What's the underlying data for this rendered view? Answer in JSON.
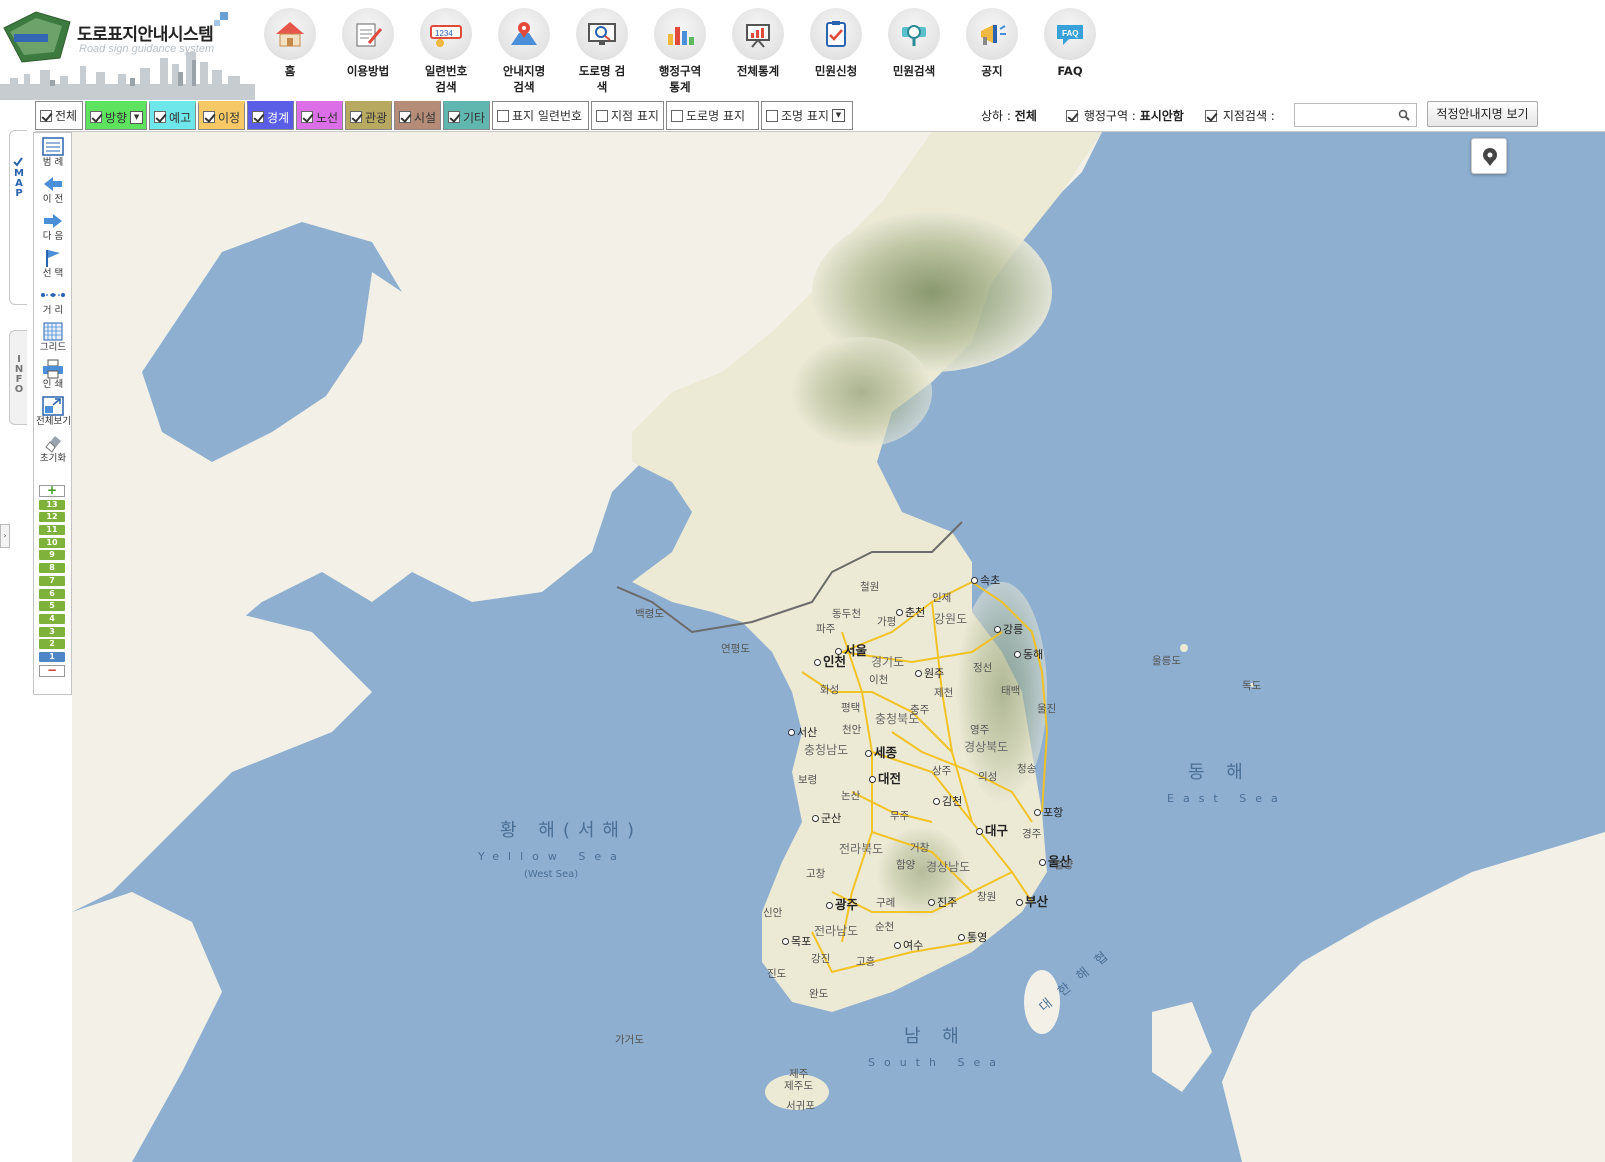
{
  "header": {
    "title": "도로표지안내시스템",
    "subtitle": "Road sign guidance system"
  },
  "nav": [
    {
      "label": "홈",
      "icon": "home-icon"
    },
    {
      "label": "이용방법",
      "icon": "guide-icon"
    },
    {
      "label": "일련번호\n검색",
      "icon": "serial-number-icon"
    },
    {
      "label": "안내지명\n검색",
      "icon": "place-pin-icon"
    },
    {
      "label": "도로명 검\n색",
      "icon": "road-search-icon"
    },
    {
      "label": "행정구역\n통계",
      "icon": "bar-chart-icon"
    },
    {
      "label": "전체통계",
      "icon": "presentation-chart-icon"
    },
    {
      "label": "민원신청",
      "icon": "clipboard-check-icon"
    },
    {
      "label": "민원검색",
      "icon": "magnifier-icon"
    },
    {
      "label": "공지",
      "icon": "megaphone-icon"
    },
    {
      "label": "FAQ",
      "icon": "faq-bubble-icon"
    }
  ],
  "filters": [
    {
      "label": "전체",
      "checked": true,
      "color": "#ffffff",
      "dropdown": false
    },
    {
      "label": "방향",
      "checked": true,
      "color": "#5ee35e",
      "dropdown": true
    },
    {
      "label": "예고",
      "checked": true,
      "color": "#6ee7ea",
      "dropdown": false
    },
    {
      "label": "이정",
      "checked": true,
      "color": "#f6c866",
      "dropdown": false
    },
    {
      "label": "경계",
      "checked": true,
      "color": "#5a5ee6",
      "dropdown": false
    },
    {
      "label": "노선",
      "checked": true,
      "color": "#dc6fe8",
      "dropdown": false
    },
    {
      "label": "관광",
      "checked": true,
      "color": "#b8a960",
      "dropdown": false
    },
    {
      "label": "시설",
      "checked": true,
      "color": "#b58c78",
      "dropdown": false
    },
    {
      "label": "기타",
      "checked": true,
      "color": "#5fb7b0",
      "dropdown": false
    },
    {
      "label": "표지 일련번호",
      "checked": false,
      "color": "#ffffff",
      "dropdown": false
    },
    {
      "label": "지점 표지",
      "checked": false,
      "color": "#ffffff",
      "dropdown": false
    },
    {
      "label": "도로명 표지",
      "checked": false,
      "color": "#ffffff",
      "dropdown": false
    },
    {
      "label": "조명 표지",
      "checked": false,
      "color": "#ffffff",
      "dropdown": true
    }
  ],
  "status": {
    "direction_label": "상하 :",
    "direction_value": "전체",
    "admin_label": "행정구역 :",
    "admin_value": "표시안함",
    "point_search_label": "지점검색 :",
    "search_value": "",
    "map_button": "적정안내지명 보기"
  },
  "side_tabs": {
    "map": "MAP",
    "info": "INFO"
  },
  "tools": [
    {
      "label": "범 례",
      "icon": "legend-icon"
    },
    {
      "label": "이 전",
      "icon": "arrow-left-icon"
    },
    {
      "label": "다 음",
      "icon": "arrow-right-icon"
    },
    {
      "label": "선 택",
      "icon": "flag-icon"
    },
    {
      "label": "거 리",
      "icon": "distance-icon"
    },
    {
      "label": "그리드",
      "icon": "grid-icon"
    },
    {
      "label": "인 쇄",
      "icon": "printer-icon"
    },
    {
      "label": "전체보기",
      "icon": "full-extent-icon"
    },
    {
      "label": "초기화",
      "icon": "eraser-icon"
    }
  ],
  "zoom": {
    "plus": "+",
    "minus": "−",
    "levels": [
      "13",
      "12",
      "11",
      "10",
      "9",
      "8",
      "7",
      "6",
      "5",
      "4",
      "3",
      "2",
      "1"
    ],
    "current": "1"
  },
  "map": {
    "seas": {
      "yellow_kr": "황 해(서해)",
      "yellow_en": "Yellow Sea",
      "yellow_sub": "(West Sea)",
      "east_kr": "동 해",
      "east_en": "East Sea",
      "south_kr": "남 해",
      "south_en": "South Sea",
      "strait": "대 한 해 협"
    },
    "major_cities": [
      "서울",
      "인천",
      "세종",
      "대전",
      "대구",
      "광주",
      "부산",
      "울산"
    ],
    "cities": [
      "속초",
      "춘천",
      "강릉",
      "동해",
      "원주",
      "서산",
      "김천",
      "군산",
      "포항",
      "진주",
      "목포",
      "여수",
      "통영"
    ],
    "provinces": [
      "경기도",
      "강원도",
      "충청북도",
      "충청남도",
      "경상북도",
      "전라북도",
      "경상남도",
      "전라남도"
    ],
    "places": [
      "철원",
      "인제",
      "동두천",
      "가평",
      "파주",
      "백령도",
      "연평도",
      "화성",
      "이천",
      "정선",
      "평택",
      "제천",
      "충주",
      "태백",
      "천안",
      "울진",
      "영주",
      "보령",
      "상주",
      "의성",
      "청송",
      "논산",
      "무주",
      "경주",
      "거창",
      "함양",
      "밀양",
      "고창",
      "구례",
      "창원",
      "순천",
      "신안",
      "강진",
      "고흥",
      "진도",
      "완도",
      "가거도",
      "울릉도",
      "독도",
      "제주",
      "제주도",
      "서귀포"
    ]
  }
}
